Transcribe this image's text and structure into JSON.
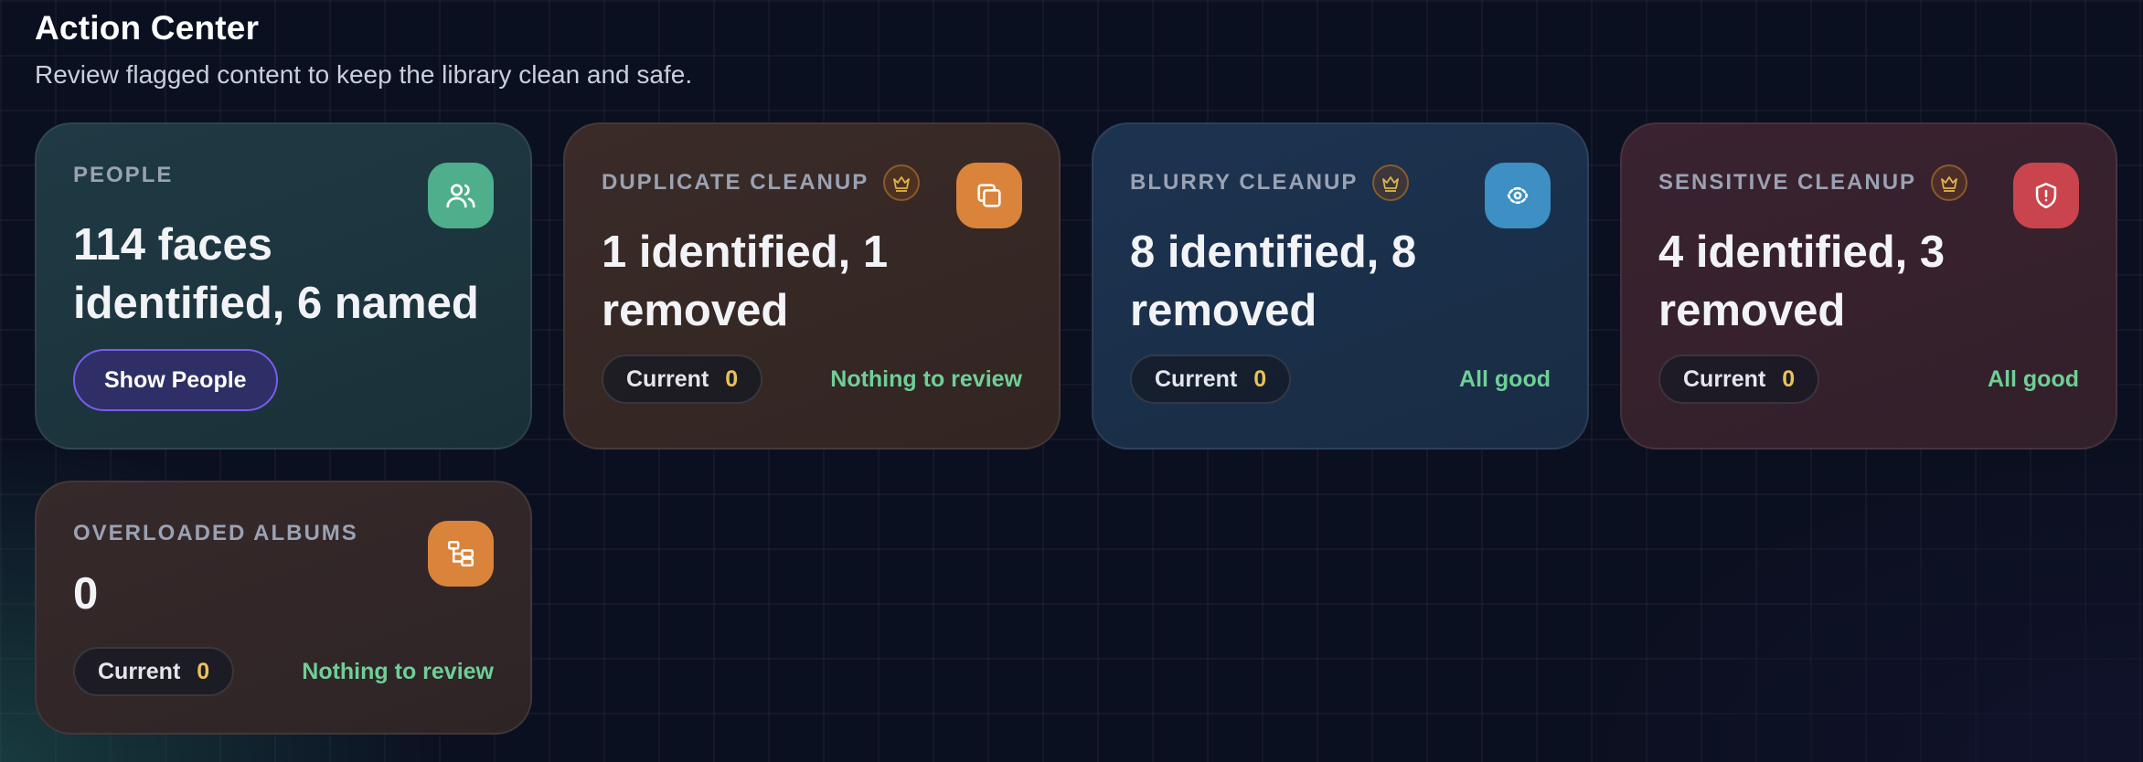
{
  "header": {
    "title": "Action Center",
    "subtitle": "Review flagged content to keep the library clean and safe."
  },
  "cards": {
    "people": {
      "label": "PEOPLE",
      "headline": "114 faces identified, 6 named",
      "button_label": "Show People",
      "icon": "users-icon",
      "accent": "#4fae8c"
    },
    "duplicate": {
      "label": "DUPLICATE CLEANUP",
      "headline": "1 identified, 1 removed",
      "pill_label": "Current",
      "pill_count": "0",
      "status": "Nothing to review",
      "icon": "copy-icon",
      "accent": "#d9843a"
    },
    "blurry": {
      "label": "BLURRY CLEANUP",
      "headline": "8 identified, 8 removed",
      "pill_label": "Current",
      "pill_count": "0",
      "status": "All good",
      "icon": "eye-focus-icon",
      "accent": "#3d8fc4"
    },
    "sensitive": {
      "label": "SENSITIVE CLEANUP",
      "headline": "4 identified, 3 removed",
      "pill_label": "Current",
      "pill_count": "0",
      "status": "All good",
      "icon": "shield-alert-icon",
      "accent": "#c9444c"
    },
    "albums": {
      "label": "OVERLOADED ALBUMS",
      "headline": "0",
      "pill_label": "Current",
      "pill_count": "0",
      "status": "Nothing to review",
      "icon": "folder-tree-icon",
      "accent": "#d9843a"
    }
  },
  "colors": {
    "status_green": "#6fcf97",
    "count_yellow": "#e8c25a",
    "premium_gold": "#e0b34a"
  }
}
